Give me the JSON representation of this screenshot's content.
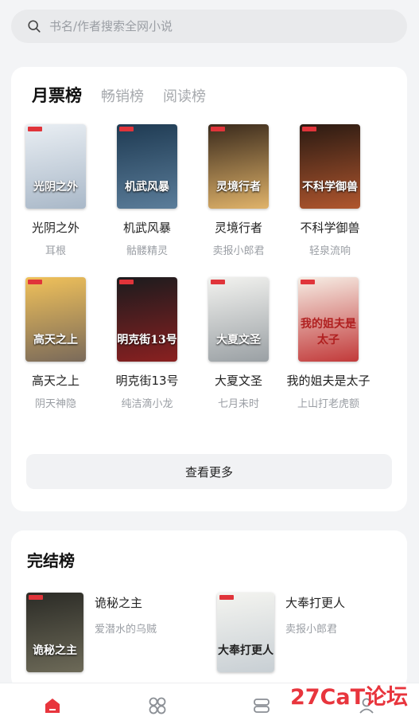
{
  "search": {
    "placeholder": "书名/作者搜索全网小说"
  },
  "ranking": {
    "tabs": [
      {
        "label": "月票榜",
        "active": true
      },
      {
        "label": "畅销榜",
        "active": false
      },
      {
        "label": "阅读榜",
        "active": false
      }
    ],
    "books": [
      {
        "title": "光阴之外",
        "author": "耳根",
        "cover_text": "光阴之外",
        "colors": [
          "#e9eef3",
          "#a9b8c8"
        ]
      },
      {
        "title": "机武风暴",
        "author": "骷髅精灵",
        "cover_text": "机武风暴",
        "colors": [
          "#1e3a52",
          "#5b7d9a"
        ]
      },
      {
        "title": "灵境行者",
        "author": "卖报小郎君",
        "cover_text": "灵境行者",
        "colors": [
          "#3a2a1c",
          "#e0b36a"
        ]
      },
      {
        "title": "不科学御兽",
        "author": "轻泉流响",
        "cover_text": "不科学御兽",
        "colors": [
          "#2a1a12",
          "#b0562e"
        ]
      },
      {
        "title": "高天之上",
        "author": "阴天神隐",
        "cover_text": "高天之上",
        "colors": [
          "#f0c15a",
          "#7a6a5a"
        ]
      },
      {
        "title": "明克街13号",
        "author": "纯洁滴小龙",
        "cover_text": "明克街13号",
        "colors": [
          "#1b1b1e",
          "#8a2020"
        ]
      },
      {
        "title": "大夏文圣",
        "author": "七月未时",
        "cover_text": "大夏文圣",
        "colors": [
          "#f2f2ef",
          "#9aa0a4"
        ]
      },
      {
        "title": "我的姐夫是太子",
        "author": "上山打老虎额",
        "cover_text": "我的姐夫是太子",
        "colors": [
          "#f6ede4",
          "#c23a3a"
        ]
      }
    ],
    "more_label": "查看更多"
  },
  "finished": {
    "title": "完结榜",
    "books": [
      {
        "title": "诡秘之主",
        "author": "爱潜水的乌贼",
        "cover_text": "诡秘之主",
        "colors": [
          "#2b2b26",
          "#6d6a58"
        ]
      },
      {
        "title": "大奉打更人",
        "author": "卖报小郎君",
        "cover_text": "大奉打更人",
        "colors": [
          "#f4f4f0",
          "#c8cfd4"
        ]
      }
    ]
  },
  "nav": {
    "accent": "#e8353d",
    "items": [
      {
        "icon": "home-icon",
        "active": true
      },
      {
        "icon": "category-icon",
        "active": false
      },
      {
        "icon": "bookshelf-icon",
        "active": false
      },
      {
        "icon": "profile-icon",
        "active": false
      }
    ]
  },
  "watermark": "27CaT论坛"
}
